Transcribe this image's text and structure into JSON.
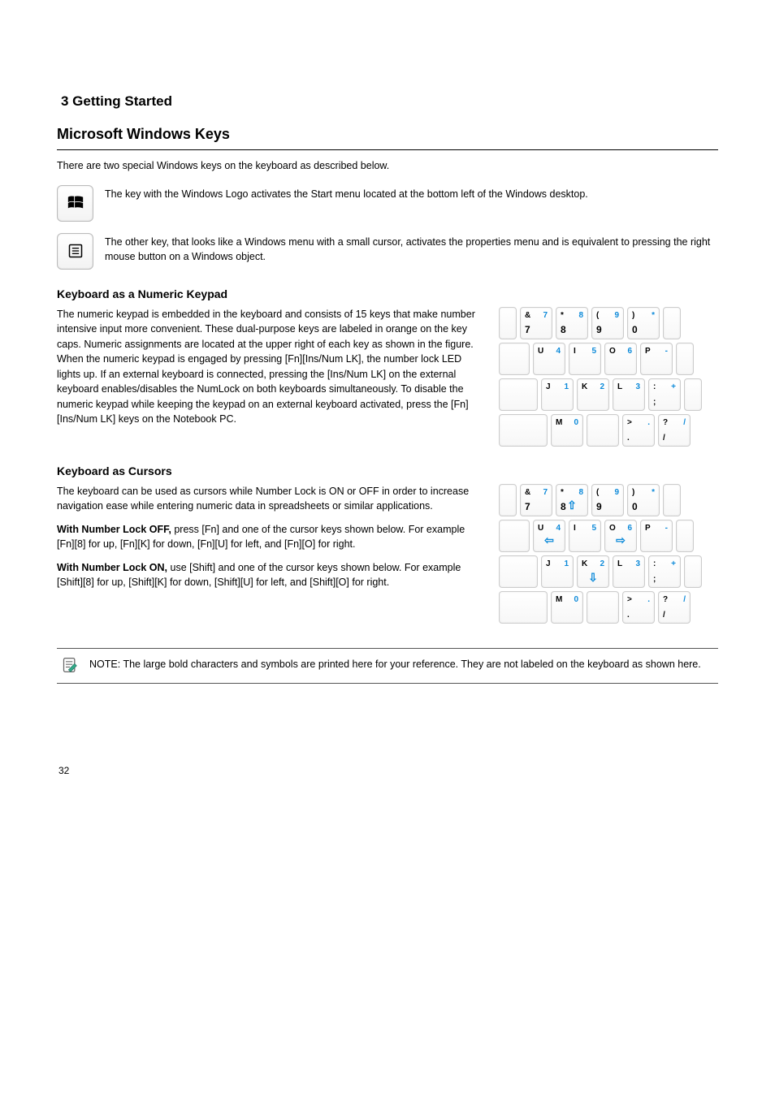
{
  "heading_runner": "3    Getting Started",
  "section_windows": {
    "title": "Microsoft Windows Keys",
    "intro": "There are two special Windows keys on the keyboard as described below.",
    "win_key_desc": "The key with the Windows Logo activates the Start menu located at the bottom left of the Windows desktop.",
    "menu_key_desc": "The other key, that looks like a Windows menu with a small cursor, activates the properties menu and is equivalent to pressing the right mouse button on a Windows object."
  },
  "section_numeric": {
    "title": "Keyboard as a Numeric Keypad",
    "desc": "The numeric keypad is embedded in the keyboard and consists of 15 keys that make number intensive input more convenient. These dual-purpose keys are labeled in orange on the key caps. Numeric assignments are located at the upper right of each key as shown in the figure. When the numeric keypad is engaged by pressing [Fn][Ins/Num LK], the number lock LED lights up. If an external keyboard is connected, pressing the [Ins/Num LK] on the external keyboard enables/disables the NumLock on both keyboards simultaneously. To disable the numeric keypad while keeping the keypad on an external keyboard activated, press the [Fn][Ins/Num LK] keys on the Notebook PC."
  },
  "section_cursors": {
    "title": "Keyboard as Cursors",
    "desc": "The keyboard can be used as cursors while Number Lock is ON or OFF in order to increase navigation ease while entering numeric data in spreadsheets or similar applications.",
    "on_desc_prefix": "With Number Lock OFF,",
    "on_desc": " press [Fn] and one of the cursor keys shown below. For example [Fn][8] for up, [Fn][K] for down, [Fn][U] for left, and [Fn][O] for right.",
    "off_desc_prefix": "With Number Lock ON,",
    "off_desc": " use [Shift] and one of the cursor keys shown below. For example [Shift][8] for up, [Shift][K] for down, [Shift][U] for left, and [Shift][O] for right."
  },
  "keypad": {
    "row1": [
      {
        "tl": "&",
        "tr": "7",
        "bl": "7"
      },
      {
        "tl": "*",
        "tr": "8",
        "bl": "8"
      },
      {
        "tl": "(",
        "tr": "9",
        "bl": "9"
      },
      {
        "tl": ")",
        "tr": "*",
        "bl": "0"
      }
    ],
    "row2": [
      {
        "tl": "U",
        "tr": "4"
      },
      {
        "tl": "I",
        "tr": "5"
      },
      {
        "tl": "O",
        "tr": "6"
      },
      {
        "tl": "P",
        "tr": "-"
      }
    ],
    "row3": [
      {
        "tl": "J",
        "tr": "1"
      },
      {
        "tl": "K",
        "tr": "2"
      },
      {
        "tl": "L",
        "tr": "3"
      },
      {
        "tl": ":",
        "tr": "+",
        "bl": ";"
      }
    ],
    "row4": [
      {
        "tl": "M",
        "tr": "0"
      },
      {
        "tl": ">",
        "tr": ".",
        "bl": "."
      },
      {
        "tl": "?",
        "tr": "/",
        "bl": "/"
      }
    ]
  },
  "note": {
    "text": "NOTE: The large bold characters and symbols are printed here for your reference. They are not labeled on the keyboard as shown here."
  },
  "footer": {
    "page": "32"
  }
}
